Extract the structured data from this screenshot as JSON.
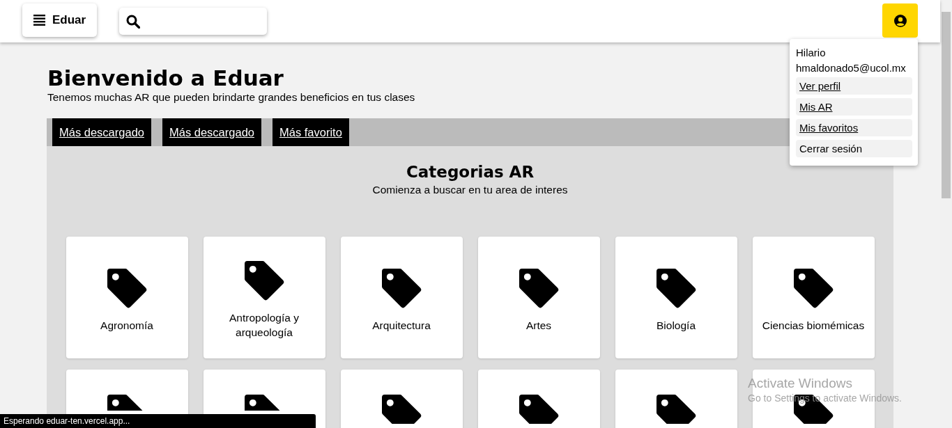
{
  "header": {
    "menu_label": "Eduar"
  },
  "user_menu": {
    "open": true,
    "name": "Hilario",
    "email": "hmaldonado5@ucol.mx",
    "items": [
      {
        "label": "Ver perfil",
        "kind": "link"
      },
      {
        "label": "Mis AR",
        "kind": "link"
      },
      {
        "label": "Mis favoritos",
        "kind": "link"
      },
      {
        "label": "Cerrar sesión",
        "kind": "action"
      }
    ]
  },
  "hero": {
    "title": "Bienvenido a Eduar",
    "subtitle": "Tenemos muchas AR que pueden brindarte grandes beneficios en tus clases"
  },
  "tabs": [
    {
      "label": "Más descargado"
    },
    {
      "label": "Más descargado"
    },
    {
      "label": "Más favorito"
    }
  ],
  "categories": {
    "title": "Categorias AR",
    "subtitle": "Comienza a buscar en tu area de interes",
    "items": [
      {
        "kind": "card",
        "label": "Agronomía"
      },
      {
        "kind": "card",
        "label": "Antropología y arqueología"
      },
      {
        "kind": "card",
        "label": "Arquitectura"
      },
      {
        "kind": "card",
        "label": "Artes"
      },
      {
        "kind": "card",
        "label": "Biología"
      },
      {
        "kind": "card",
        "label": "Ciencias biomémicas"
      },
      {
        "kind": "partial"
      },
      {
        "kind": "partial"
      },
      {
        "kind": "partial"
      },
      {
        "kind": "partial"
      },
      {
        "kind": "partial"
      },
      {
        "kind": "partial"
      }
    ]
  },
  "status_bar": "Esperando eduar-ten.vercel.app...",
  "os_notice": {
    "title": "Activate Windows",
    "text": "Go to Settings to activate Windows."
  }
}
